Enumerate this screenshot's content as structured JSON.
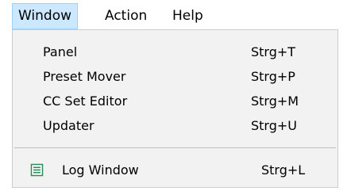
{
  "menubar": {
    "items": [
      {
        "label": "Window"
      },
      {
        "label": "Action"
      },
      {
        "label": "Help"
      }
    ]
  },
  "window_menu": {
    "items": [
      {
        "label": "Panel",
        "shortcut": "Strg+T"
      },
      {
        "label": "Preset Mover",
        "shortcut": "Strg+P"
      },
      {
        "label": "CC Set Editor",
        "shortcut": "Strg+M"
      },
      {
        "label": "Updater",
        "shortcut": "Strg+U"
      }
    ],
    "log_item": {
      "label": "Log Window",
      "shortcut": "Strg+L",
      "icon": "log-list-icon"
    }
  },
  "colors": {
    "active_menu_bg": "#cce8ff",
    "active_menu_border": "#99d1ff",
    "dropdown_bg": "#f2f2f2",
    "icon_green": "#2e8b57"
  }
}
